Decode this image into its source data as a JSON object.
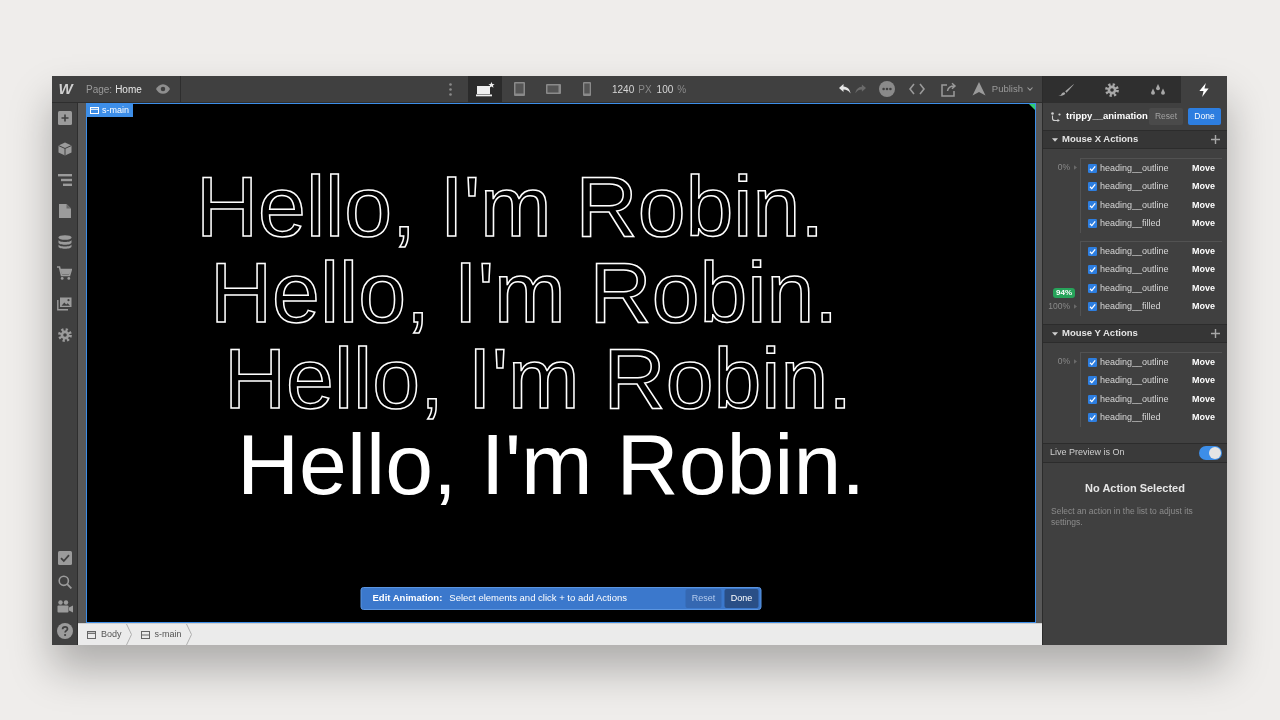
{
  "top_bar": {
    "logo": "W",
    "page_label": "Page:",
    "page_name": "Home",
    "devices": [
      {
        "selected": true
      },
      {
        "selected": false
      },
      {
        "selected": false
      },
      {
        "selected": false
      }
    ],
    "width_value": "1240",
    "width_unit": "PX",
    "zoom_value": "100",
    "zoom_unit": "%",
    "undo": {
      "disabled": false
    },
    "redo": {
      "disabled": true
    },
    "publish": "Publish"
  },
  "canvas": {
    "element_label": "s-main",
    "headings": [
      {
        "kind": "outline",
        "text": "Hello, I'm Robin."
      },
      {
        "kind": "outline",
        "text": "Hello, I'm Robin."
      },
      {
        "kind": "outline",
        "text": "Hello, I'm Robin."
      },
      {
        "kind": "filled",
        "text": "Hello, I'm Robin."
      }
    ],
    "edit_bar": {
      "title": "Edit Animation:",
      "message": "Select elements and click + to add Actions",
      "reset": {
        "label": "Reset",
        "disabled": true
      },
      "done": "Done"
    }
  },
  "breadcrumb": [
    "Body",
    "s-main"
  ],
  "right_panel": {
    "tabs": [
      {
        "selected": false
      },
      {
        "selected": false
      },
      {
        "selected": false
      },
      {
        "selected": true
      }
    ],
    "animation": {
      "name": "trippy__animation",
      "reset": {
        "label": "Reset",
        "disabled": true
      },
      "done": "Done"
    },
    "sections": [
      {
        "title": "Mouse X Actions",
        "expanded": true,
        "groups": [
          {
            "keyframe": "0%",
            "actions": [
              {
                "target": "heading__outline",
                "checked": true,
                "action": "Move"
              },
              {
                "target": "heading__outline",
                "checked": true,
                "action": "Move"
              },
              {
                "target": "heading__outline",
                "checked": true,
                "action": "Move"
              },
              {
                "target": "heading__filled",
                "checked": true,
                "action": "Move"
              }
            ]
          },
          {
            "keyframe": "100%",
            "badge": "94%",
            "actions": [
              {
                "target": "heading__outline",
                "checked": true,
                "action": "Move"
              },
              {
                "target": "heading__outline",
                "checked": true,
                "action": "Move"
              },
              {
                "target": "heading__outline",
                "checked": true,
                "action": "Move"
              },
              {
                "target": "heading__filled",
                "checked": true,
                "action": "Move"
              }
            ]
          }
        ]
      },
      {
        "title": "Mouse Y Actions",
        "expanded": true,
        "groups": [
          {
            "keyframe": "0%",
            "actions": [
              {
                "target": "heading__outline",
                "checked": true,
                "action": "Move"
              },
              {
                "target": "heading__outline",
                "checked": true,
                "action": "Move"
              },
              {
                "target": "heading__outline",
                "checked": true,
                "action": "Move"
              },
              {
                "target": "heading__filled",
                "checked": true,
                "action": "Move"
              }
            ]
          }
        ]
      }
    ],
    "live_preview": {
      "label": "Live Preview is On",
      "on": true
    },
    "detail": {
      "title": "No Action Selected",
      "description": "Select an action in the list to adjust its settings."
    }
  }
}
